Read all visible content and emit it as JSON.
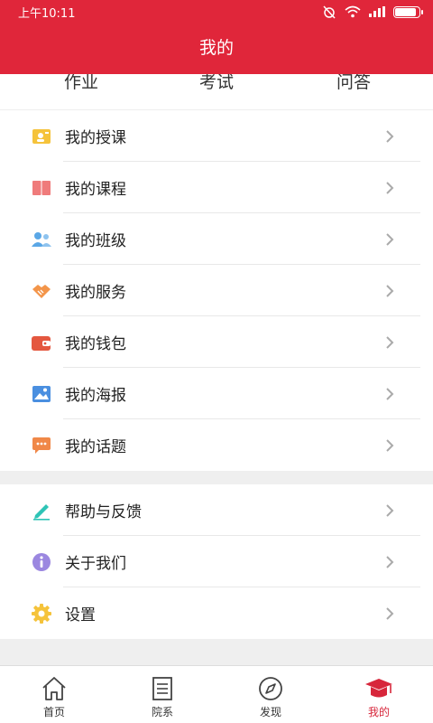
{
  "status_bar": {
    "time": "上午10:11"
  },
  "header": {
    "title": "我的"
  },
  "tabs": [
    "作业",
    "考试",
    "问答"
  ],
  "section1": [
    {
      "label": "我的授课",
      "icon": "teaching-icon",
      "color": "#f5c33b"
    },
    {
      "label": "我的课程",
      "icon": "book-icon",
      "color": "#ef7b7b"
    },
    {
      "label": "我的班级",
      "icon": "class-people-icon",
      "color": "#5aa7e6"
    },
    {
      "label": "我的服务",
      "icon": "handshake-icon",
      "color": "#f3954a"
    },
    {
      "label": "我的钱包",
      "icon": "wallet-icon",
      "color": "#e4573f"
    },
    {
      "label": "我的海报",
      "icon": "poster-image-icon",
      "color": "#4a8fe0"
    },
    {
      "label": "我的话题",
      "icon": "topic-chat-icon",
      "color": "#f08848"
    }
  ],
  "section2": [
    {
      "label": "帮助与反馈",
      "icon": "pen-feedback-icon",
      "color": "#2ec4b6"
    },
    {
      "label": "关于我们",
      "icon": "info-icon",
      "color": "#9b87e0"
    },
    {
      "label": "设置",
      "icon": "gear-icon",
      "color": "#f5c33b"
    }
  ],
  "bottom_nav": [
    {
      "label": "首页",
      "icon": "home-icon"
    },
    {
      "label": "院系",
      "icon": "list-doc-icon"
    },
    {
      "label": "发现",
      "icon": "compass-icon"
    },
    {
      "label": "我的",
      "icon": "graduation-cap-icon",
      "active": true
    }
  ],
  "colors": {
    "brand_red": "#e0263a",
    "battery_level": 0.9
  }
}
